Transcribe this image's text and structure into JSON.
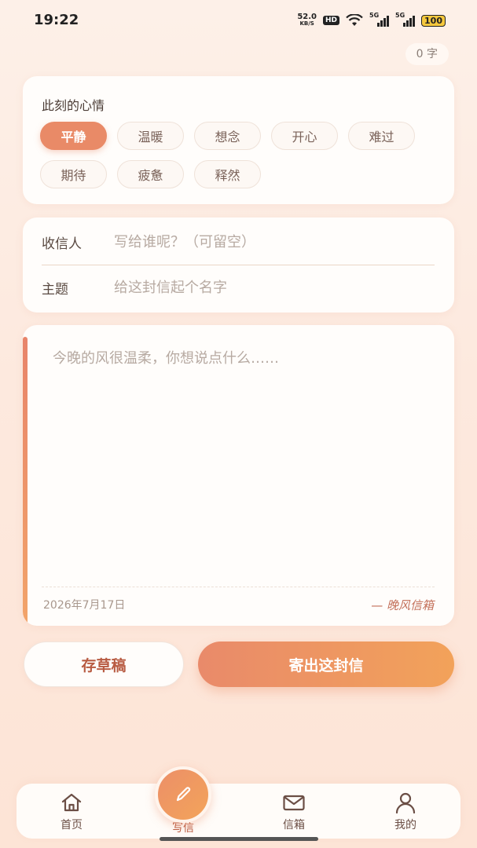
{
  "status": {
    "time": "19:22",
    "net_speed": "52.0",
    "net_unit": "KB/S",
    "hd": "HD",
    "sig1": "5G",
    "sig2": "5G",
    "battery": "100"
  },
  "word_count": "0 字",
  "mood": {
    "title": "此刻的心情",
    "options": [
      "平静",
      "温暖",
      "想念",
      "开心",
      "难过",
      "期待",
      "疲惫",
      "释然"
    ],
    "selected": "平静"
  },
  "form": {
    "recipient_label": "收信人",
    "recipient_placeholder": "写给谁呢？（可留空）",
    "subject_label": "主题",
    "subject_placeholder": "给这封信起个名字"
  },
  "letter": {
    "placeholder": "今晚的风很温柔，你想说点什么……",
    "date": "2026年7月17日",
    "signature": "— 晚风信箱"
  },
  "actions": {
    "save_draft": "存草稿",
    "send": "寄出这封信"
  },
  "tabs": {
    "home": "首页",
    "write": "写信",
    "inbox": "信箱",
    "me": "我的"
  },
  "colors": {
    "accent": "#e98a67",
    "accent_end": "#f2a25a",
    "background": "#fdf0e8"
  }
}
